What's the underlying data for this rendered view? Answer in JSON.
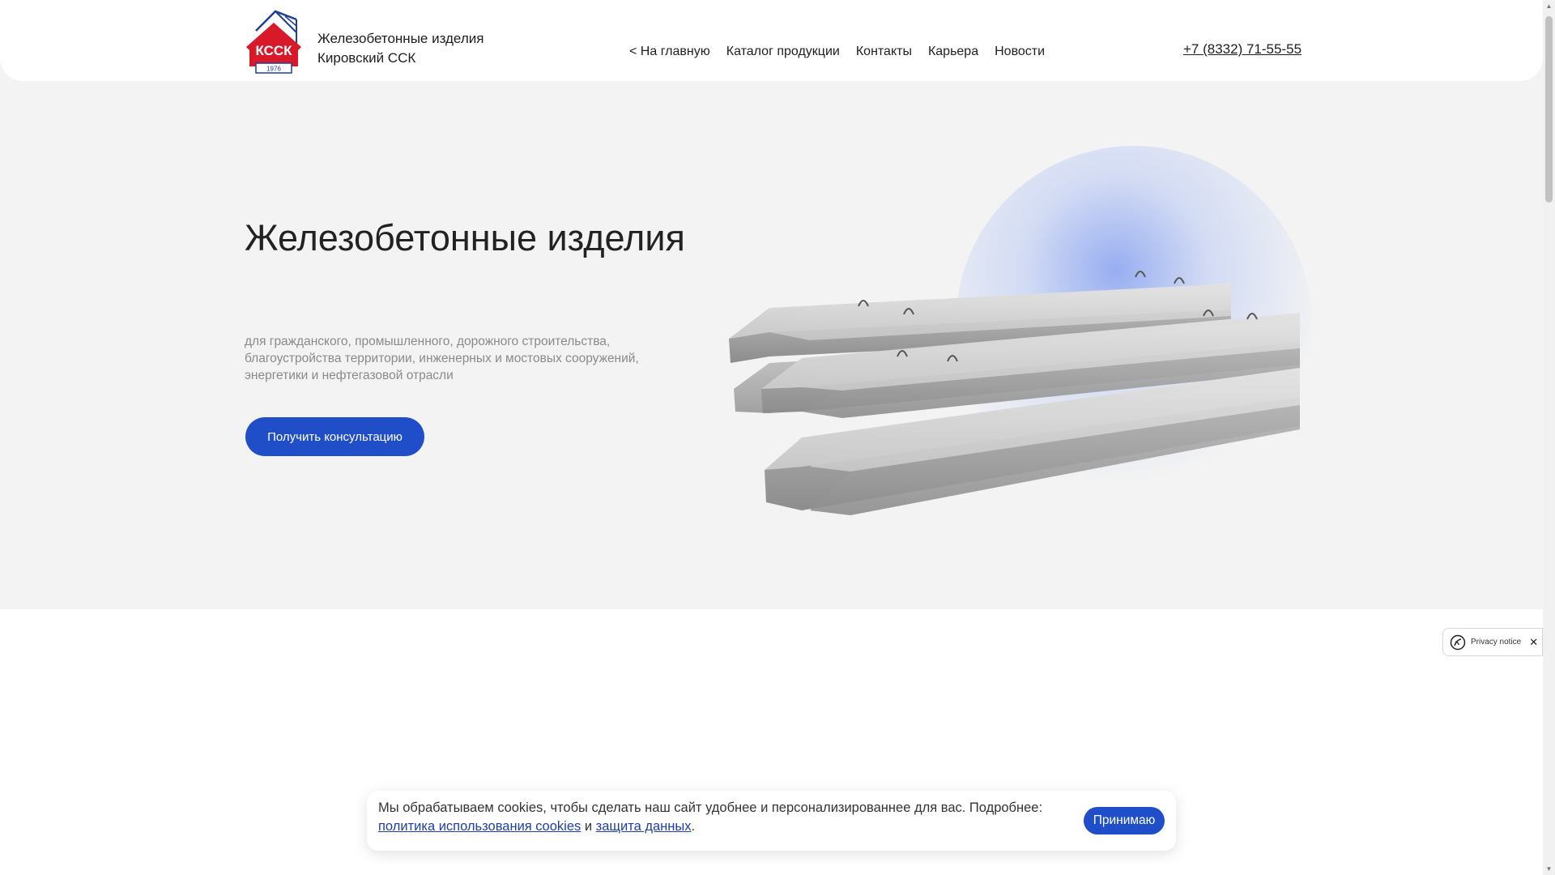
{
  "header": {
    "brand_line1": "Железобетонные изделия",
    "brand_line2": "Кировский ССК",
    "logo_text": "КССК",
    "logo_year": "1976",
    "phone": "+7 (8332) 71-55-55"
  },
  "nav": {
    "items": [
      {
        "label": "< На главную"
      },
      {
        "label": "Каталог продукции"
      },
      {
        "label": "Контакты"
      },
      {
        "label": "Карьера"
      },
      {
        "label": "Новости"
      }
    ]
  },
  "hero": {
    "title": "Железобетонные изделия",
    "subtitle": "для гражданского, промышленного, дорожного строительства, благоустройства территории, инженерных и мостовых сооружений, энергетики и нефтегазовой отрасли",
    "cta_label": "Получить консультацию"
  },
  "privacy": {
    "label": "Privacy notice",
    "close": "✕"
  },
  "cookie": {
    "text_before": "Мы обрабатываем cookies, чтобы сделать наш сайт удобнее и персонализированнее для вас. Подробнее:",
    "link1": "политика использования cookies",
    "conjunction": "и",
    "link2": "защита данных",
    "period": ".",
    "accept_label": "Принимаю"
  },
  "colors": {
    "accent": "#1f4ec8",
    "logo_red": "#d7192a",
    "logo_blue": "#1f3f9a",
    "hero_bg": "#f3f3f3"
  }
}
